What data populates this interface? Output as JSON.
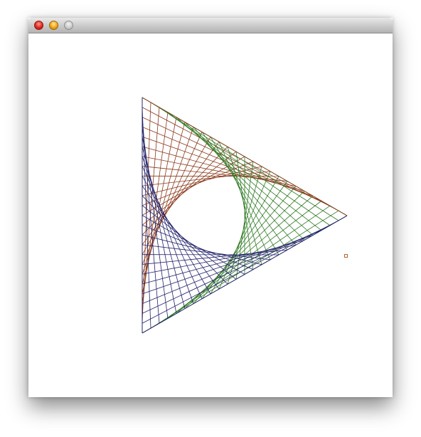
{
  "window": {
    "title": "",
    "controls": [
      "close",
      "minimize",
      "zoom"
    ]
  },
  "colors": {
    "series_a": "#8b3a1c",
    "series_b": "#2e7a22",
    "series_c": "#23236b",
    "marker": "#c06030"
  },
  "figure": {
    "description_type": "line-stitch triangle",
    "stitch_segments_per_side": 24
  }
}
